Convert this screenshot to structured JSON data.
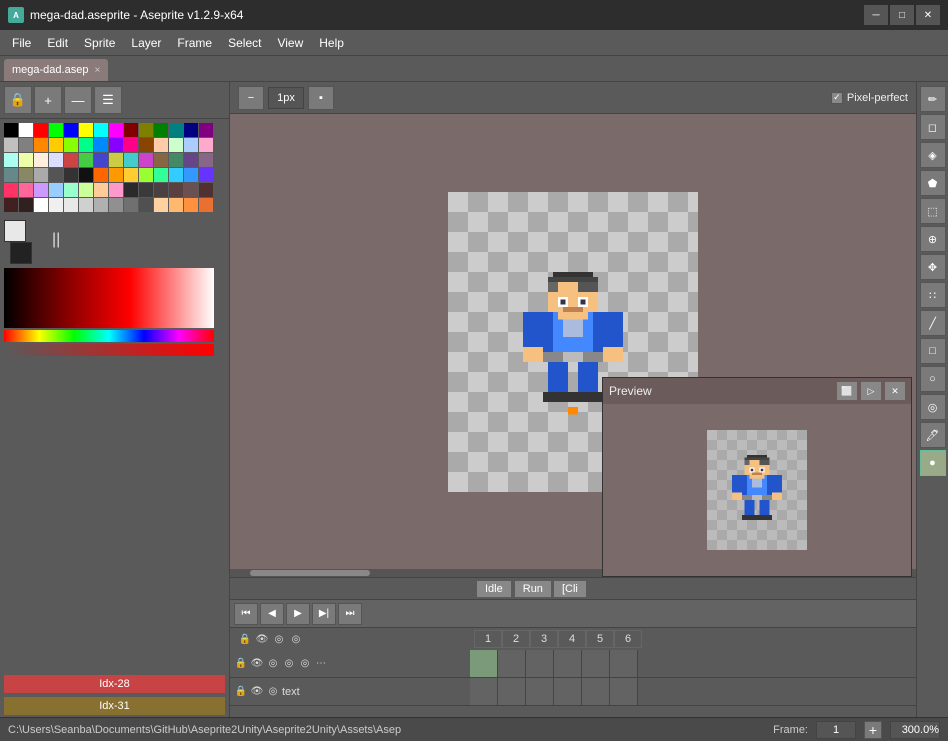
{
  "titlebar": {
    "app_icon": "A",
    "title": "mega-dad.aseprite - Aseprite v1.2.9-x64",
    "minimize": "─",
    "maximize": "□",
    "close": "✕"
  },
  "menubar": {
    "items": [
      "File",
      "Edit",
      "Sprite",
      "Layer",
      "Frame",
      "Select",
      "View",
      "Help"
    ]
  },
  "tab": {
    "label": "mega-dad.asep",
    "close": "×"
  },
  "toolbar_top": {
    "lock": "🔒",
    "add": "+",
    "minus": "—",
    "menu": "☰"
  },
  "canvas_toolbar": {
    "brush_size": "1px",
    "pixel_perfect_label": "Pixel-perfect"
  },
  "palette_colors": [
    "#000000",
    "#ffffff",
    "#ff0000",
    "#00ff00",
    "#0000ff",
    "#ffff00",
    "#00ffff",
    "#ff00ff",
    "#800000",
    "#808000",
    "#008000",
    "#008080",
    "#000080",
    "#800080",
    "#c0c0c0",
    "#808080",
    "#ff8800",
    "#ffcc00",
    "#88ff00",
    "#00ff88",
    "#0088ff",
    "#8800ff",
    "#ff0088",
    "#884400",
    "#ffccaa",
    "#ccffcc",
    "#aaccff",
    "#ffaacc",
    "#aaffee",
    "#eeffaa",
    "#ffeedd",
    "#ddddff",
    "#cc4444",
    "#44cc44",
    "#4444cc",
    "#cccc44",
    "#44cccc",
    "#cc44cc",
    "#886644",
    "#448866",
    "#664488",
    "#886688",
    "#668888",
    "#888866",
    "#aaaaaa",
    "#555555",
    "#333333",
    "#111111",
    "#ff6600",
    "#ff9900",
    "#ffcc33",
    "#99ff33",
    "#33ff99",
    "#33ccff",
    "#3399ff",
    "#6633ff",
    "#ff3366",
    "#ff6699",
    "#cc99ff",
    "#99ccff",
    "#99ffcc",
    "#ccff99",
    "#ffcc99",
    "#ff99cc",
    "#2a2a2a",
    "#3a3a3a",
    "#4a4040",
    "#5a4040",
    "#6a5050",
    "#503030",
    "#402020",
    "#302020",
    "#ffffff",
    "#f0f0f0",
    "#e8e8e8",
    "#d0d0d0",
    "#b0b0b0",
    "#909090",
    "#707070",
    "#505050",
    "#ffd0a0",
    "#ffb870",
    "#ff9040",
    "#e87030",
    "#c05020",
    "#983810",
    "#702000",
    "#481000",
    "#c8e0f8",
    "#a0c8f0",
    "#78a0d8",
    "#5080c0",
    "#3060a8",
    "#184090",
    "#083078",
    "#001860"
  ],
  "fg_color": "#ffffff",
  "bg_color": "#111111",
  "named_colors": [
    {
      "label": "Idx-28",
      "color": "#c84444"
    },
    {
      "label": "Idx-31",
      "color": "#887030"
    }
  ],
  "right_tools": [
    {
      "name": "pencil",
      "symbol": "✏",
      "active": false
    },
    {
      "name": "eraser",
      "symbol": "◻",
      "active": false
    },
    {
      "name": "eyedropper",
      "symbol": "💧",
      "active": false
    },
    {
      "name": "fill",
      "symbol": "◆",
      "active": false
    },
    {
      "name": "selection",
      "symbol": "⬚",
      "active": false
    },
    {
      "name": "zoom",
      "symbol": "🔍",
      "active": false
    },
    {
      "name": "move",
      "symbol": "✥",
      "active": false
    },
    {
      "name": "spray",
      "symbol": "∷",
      "active": false
    },
    {
      "name": "line",
      "symbol": "╱",
      "active": false
    },
    {
      "name": "rect",
      "symbol": "□",
      "active": false
    },
    {
      "name": "circle",
      "symbol": "○",
      "active": false
    },
    {
      "name": "blur",
      "symbol": "◎",
      "active": false
    },
    {
      "name": "ink",
      "symbol": "🖊",
      "active": false
    },
    {
      "name": "smudge",
      "symbol": "▨",
      "active": false
    },
    {
      "name": "dark",
      "symbol": "●",
      "active": true
    }
  ],
  "preview": {
    "title": "Preview",
    "buttons": [
      "⬜",
      "▷",
      "✕"
    ]
  },
  "animation_tags": [
    "Idle",
    "Run",
    "[Cli"
  ],
  "frame_numbers": [
    "1",
    "2",
    "3",
    "4",
    "5",
    "6"
  ],
  "timeline_rows": [
    {
      "icons": [
        "🔒",
        "👁",
        "◎",
        "◎"
      ],
      "label": "",
      "has_lock": true
    },
    {
      "icons": [
        "🔒",
        "👁",
        "◎"
      ],
      "label": "text",
      "has_lock": true
    }
  ],
  "status_bar": {
    "path": "C:\\Users\\Seanba\\Documents\\GitHub\\Aseprite2Unity\\Aseprite2Unity\\Assets\\Asep",
    "frame_label": "Frame:",
    "frame_value": "1",
    "zoom_value": "300.0%"
  }
}
